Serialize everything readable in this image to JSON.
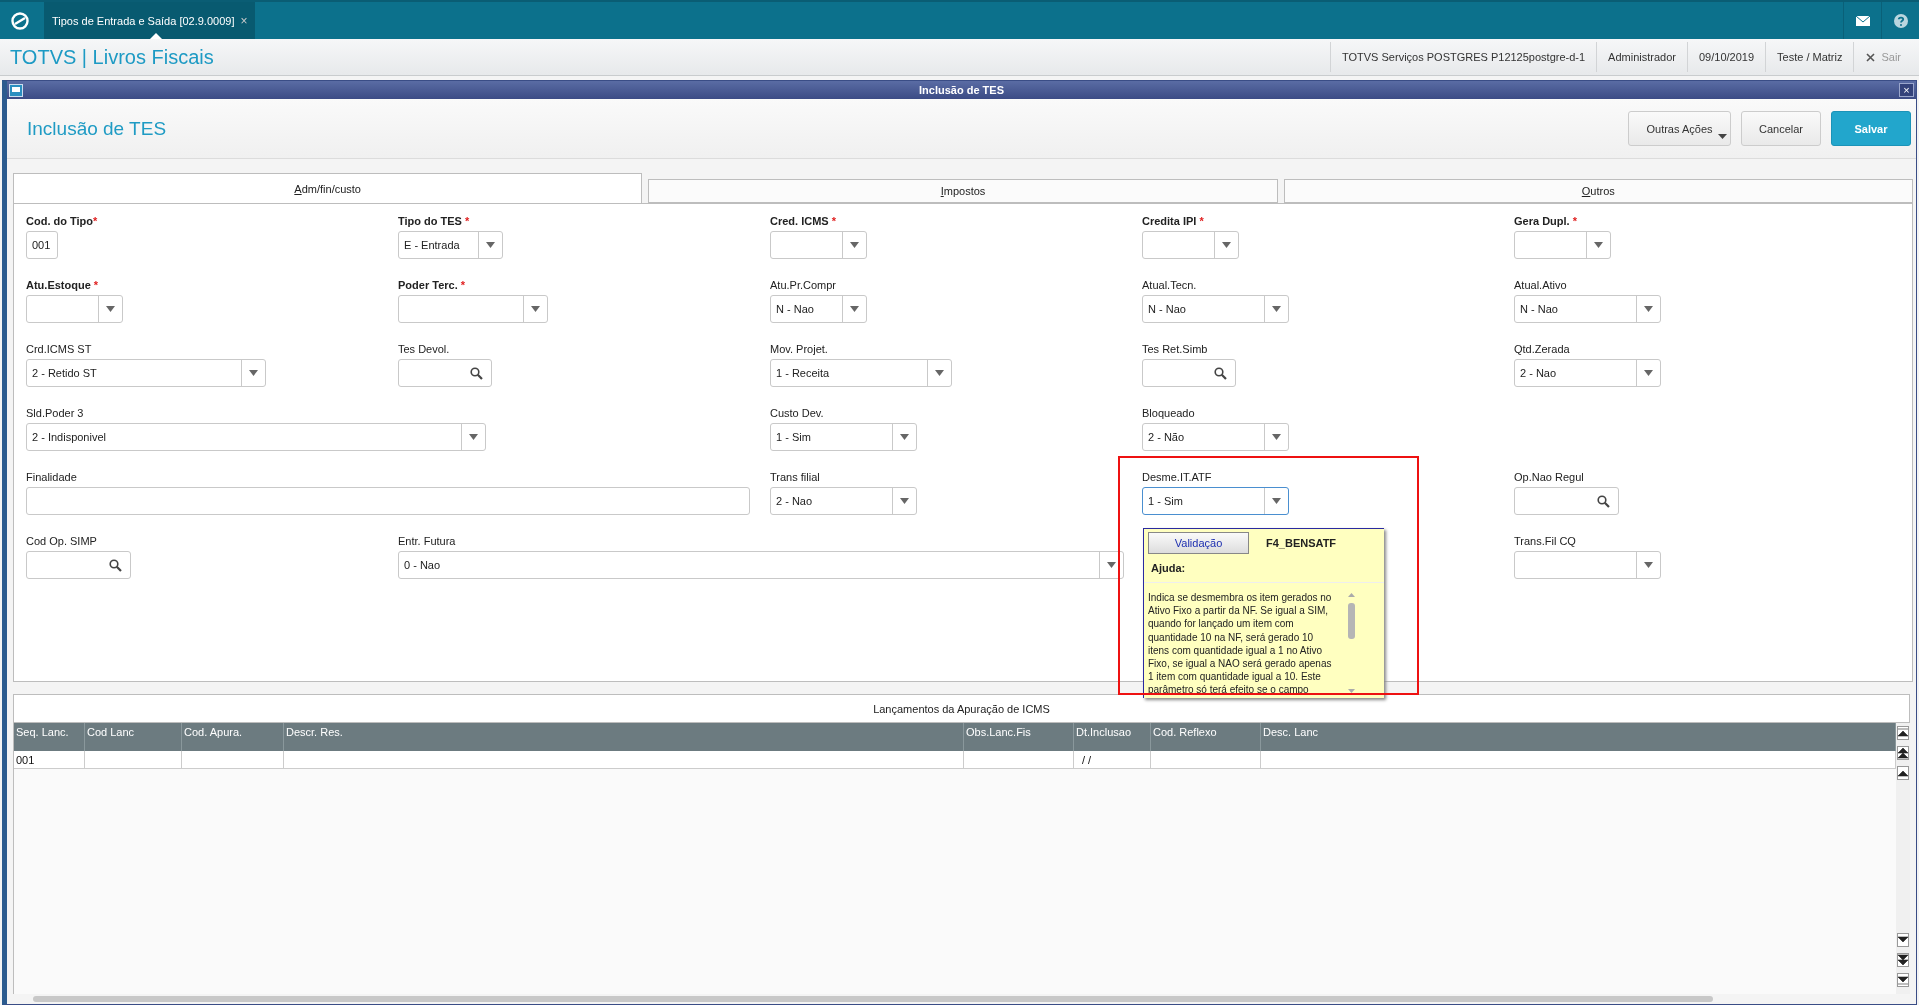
{
  "top_bar": {
    "tab": {
      "title": "Tipos de Entrada e Saída [02.9.0009]",
      "close": "×"
    }
  },
  "app_bar": {
    "title": "TOTVS | Livros Fiscais",
    "info": [
      "TOTVS Serviços POSTGRES P12125postgre-d-1",
      "Administrador",
      "09/10/2019",
      "Teste / Matriz"
    ],
    "exit": "Sair"
  },
  "dialog": {
    "title": "Inclusão de TES",
    "close": "×"
  },
  "header": {
    "title": "Inclusão de TES",
    "buttons": [
      {
        "label": "Outras Ações",
        "kind": "menu"
      },
      {
        "label": "Cancelar",
        "kind": "plain"
      },
      {
        "label": "Salvar",
        "kind": "primary"
      }
    ]
  },
  "tabs": [
    {
      "label": "Adm/fin/custo",
      "selected": true
    },
    {
      "label": "Impostos",
      "selected": false
    },
    {
      "label": "Outros",
      "selected": false
    }
  ],
  "form_rows": [
    [
      {
        "label": "Cod. do Tipo",
        "mark": "*",
        "kind": "text",
        "value": "001"
      },
      {
        "label": "Tipo do TES",
        "mark": " *",
        "kind": "select",
        "value": "E - Entrada"
      },
      {
        "label": "Cred. ICMS",
        "mark": " *",
        "kind": "select"
      },
      {
        "label": "Credita IPI",
        "mark": " *",
        "kind": "select"
      },
      {
        "label": "Gera Dupl.",
        "mark": " *",
        "kind": "select"
      }
    ],
    [
      {
        "label": "Atu.Estoque",
        "mark": " *",
        "kind": "select"
      },
      {
        "label": "Poder Terc.",
        "mark": " *",
        "kind": "select"
      },
      {
        "label": "Atu.Pr.Compr",
        "kind": "select",
        "value": "N - Nao"
      },
      {
        "label": "Atual.Tecn.",
        "kind": "select",
        "value": "N - Nao"
      },
      {
        "label": "Atual.Ativo",
        "kind": "select",
        "value": "N - Nao"
      }
    ],
    [
      {
        "label": "Crd.ICMS ST",
        "kind": "select",
        "value": "2 - Retido ST"
      },
      {
        "label": "Tes Devol.",
        "kind": "lookup"
      },
      {
        "label": "Mov. Projet.",
        "kind": "select",
        "value": "1 - Receita"
      },
      {
        "label": "Tes Ret.Simb",
        "kind": "lookup"
      },
      {
        "label": "Qtd.Zerada",
        "kind": "select",
        "value": "2 - Nao"
      }
    ],
    [
      {
        "label": "Sld.Poder 3",
        "kind": "select",
        "value": "2 - Indisponivel"
      },
      {
        "label": "Custo Dev.",
        "kind": "select",
        "value": "1 - Sim"
      },
      {
        "label": "Bloqueado",
        "kind": "select",
        "value": "2 - Não"
      }
    ],
    [
      {
        "label": "Finalidade",
        "kind": "text"
      },
      {
        "label": "Trans filial",
        "kind": "select",
        "value": "2 - Nao"
      },
      {
        "label": "Desme.IT.ATF",
        "kind": "select",
        "value": "1 - Sim",
        "focused": true
      },
      {
        "label": "Op.Nao Regul",
        "kind": "lookup"
      }
    ],
    [
      {
        "label": "Cod Op. SIMP",
        "kind": "lookup"
      },
      {
        "label": "Entr. Futura",
        "kind": "select",
        "value": "0 - Nao"
      },
      {
        "label": "Trans.Fil CQ",
        "kind": "select"
      }
    ]
  ],
  "help_popup": {
    "button": "Validação",
    "field_code": "F4_BENSATF",
    "heading": "Ajuda:",
    "text": "Indica se desmembra os item gerados no Ativo Fixo a partir da NF. Se igual a SIM, quando for lançado um item com quantidade 10 na NF, será gerado 10 itens com quantidade igual a 1 no Ativo Fixo, se igual a NAO será gerado apenas 1 item com quantidade igual a 10. Este parâmetro só terá efeito se o campo"
  },
  "grid": {
    "title": "Lançamentos da Apuração de ICMS",
    "columns": [
      "Seq. Lanc.",
      "Cod Lanc",
      "Cod. Apura.",
      "Descr. Res.",
      "Obs.Lanc.Fis",
      "Dt.Inclusao",
      "Cod. Reflexo",
      "Desc. Lanc"
    ],
    "rows": [
      [
        "001",
        null,
        null,
        null,
        null,
        "/ /",
        null,
        null
      ]
    ]
  }
}
